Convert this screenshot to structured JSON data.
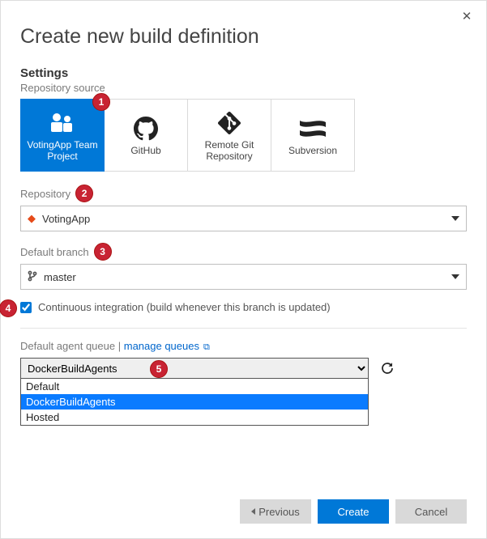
{
  "dialog": {
    "title": "Create new build definition",
    "close_tooltip": "Close"
  },
  "settings": {
    "heading": "Settings",
    "repo_source_label": "Repository source",
    "sources": [
      {
        "label": "VotingApp Team Project",
        "selected": true
      },
      {
        "label": "GitHub",
        "selected": false
      },
      {
        "label": "Remote Git Repository",
        "selected": false
      },
      {
        "label": "Subversion",
        "selected": false
      }
    ],
    "repository_label": "Repository",
    "repository_value": "VotingApp",
    "branch_label": "Default branch",
    "branch_value": "master",
    "ci_checked": true,
    "ci_label": "Continuous integration (build whenever this branch is updated)"
  },
  "queue": {
    "label": "Default agent queue",
    "manage_link": "manage queues",
    "selected": "DockerBuildAgents",
    "options": [
      "Default",
      "DockerBuildAgents",
      "Hosted"
    ]
  },
  "footer": {
    "previous": "Previous",
    "create": "Create",
    "cancel": "Cancel"
  },
  "callouts": {
    "c1": "1",
    "c2": "2",
    "c3": "3",
    "c4": "4",
    "c5": "5"
  }
}
